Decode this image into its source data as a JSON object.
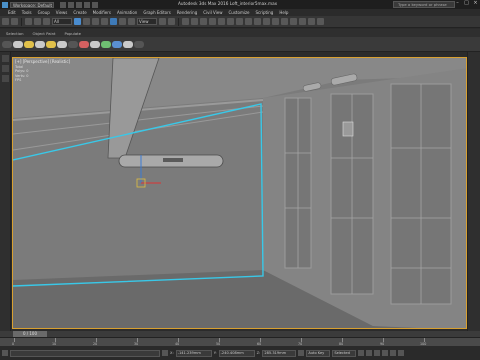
{
  "titlebar": {
    "workspace": "Workspace: Default",
    "title": "Autodesk 3ds Max 2016      Loft_interior5max.max",
    "search_placeholder": "Type a keyword or phrase"
  },
  "menu": [
    "Edit",
    "Tools",
    "Group",
    "Views",
    "Create",
    "Modifiers",
    "Animation",
    "Graph Editors",
    "Rendering",
    "Civil View",
    "Customize",
    "Scripting",
    "Help"
  ],
  "toolbar": {
    "filter_value": "All",
    "view_value": "View"
  },
  "ribbon": {
    "tabs": [
      "Selection",
      "Object Paint",
      "Populate"
    ]
  },
  "viewport": {
    "label": "[+] [Perspective] [Realistic]",
    "stats": [
      "Total",
      "Polys: 0",
      "Verts: 0",
      "FPS"
    ]
  },
  "timeline": {
    "slider_label": "0 / 100",
    "ticks": [
      "0",
      "10",
      "20",
      "30",
      "40",
      "50",
      "60",
      "70",
      "80",
      "90",
      "100"
    ]
  },
  "statusbar": {
    "x_label": "X:",
    "x_value": "-141.239mm",
    "y_label": "Y:",
    "y_value": "-240.408mm",
    "z_label": "Z:",
    "z_value": "285.319mm",
    "key_label": "Auto Key",
    "selected_label": "Selected"
  },
  "colors": {
    "accent": "#4a8ccf",
    "active_viewport_border": "#d8a030",
    "selection_cyan": "#39c8e8"
  }
}
